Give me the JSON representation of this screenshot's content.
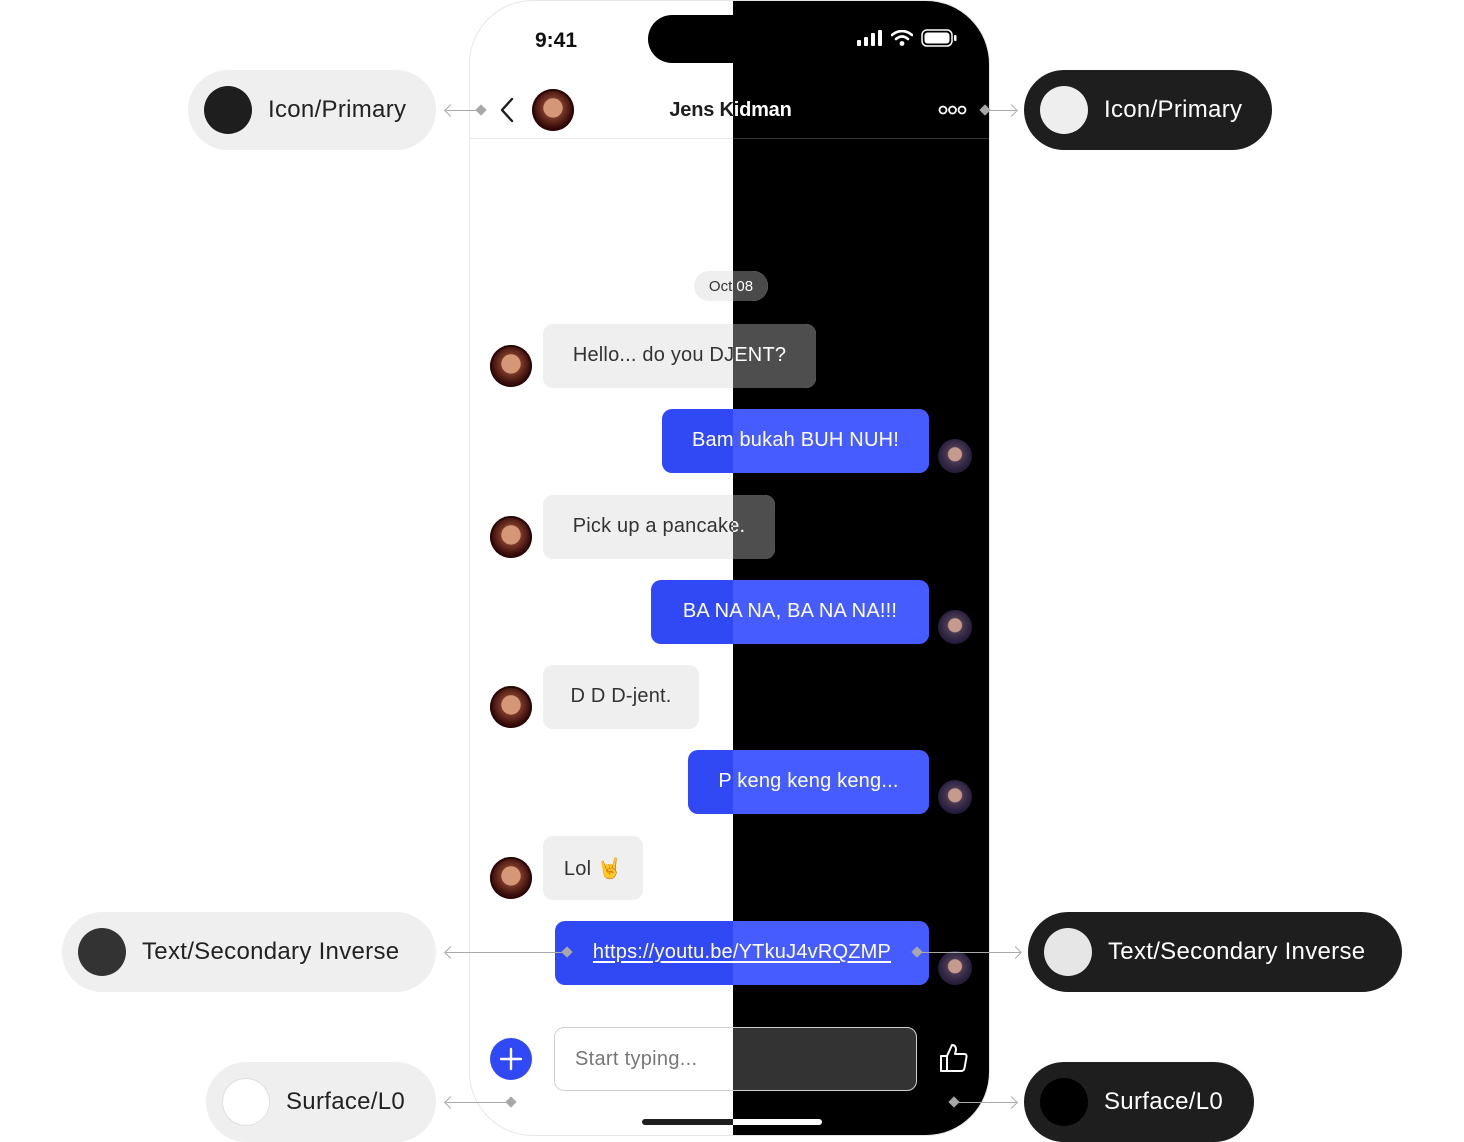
{
  "status_bar": {
    "time": "9:41"
  },
  "header": {
    "contact_name": "Jens Kidman"
  },
  "chat": {
    "date_label": "Oct 08",
    "messages": [
      {
        "side": "incoming",
        "text": "Hello... do you DJENT?"
      },
      {
        "side": "outgoing",
        "text": "Bam bukah BUH NUH!"
      },
      {
        "side": "incoming",
        "text": "Pick up a pancake."
      },
      {
        "side": "outgoing",
        "text": "BA NA NA, BA NA NA!!!"
      },
      {
        "side": "incoming",
        "text": "D D D-jent."
      },
      {
        "side": "outgoing",
        "text": "P keng keng keng..."
      },
      {
        "side": "incoming",
        "text": "Lol 🤘"
      },
      {
        "side": "outgoing",
        "text": "https://youtu.be/YTkuJ4vRQZMP",
        "is_link": true
      }
    ]
  },
  "composer": {
    "placeholder": "Start typing..."
  },
  "annotations": {
    "icon_primary_light": {
      "label": "Icon/Primary",
      "color": "#1e1e1e"
    },
    "icon_primary_dark": {
      "label": "Icon/Primary",
      "color": "#eeeeee"
    },
    "text_secondary_light": {
      "label": "Text/Secondary Inverse",
      "color": "#333333"
    },
    "text_secondary_dark": {
      "label": "Text/Secondary Inverse",
      "color": "#e6e6e6"
    },
    "surface_light": {
      "label": "Surface/L0",
      "color": "#ffffff"
    },
    "surface_dark": {
      "label": "Surface/L0",
      "color": "#000000"
    }
  },
  "colors": {
    "accent": "#3049f5",
    "accent_dark": "#465cff",
    "surface_light": "#ffffff",
    "surface_dark": "#000000"
  }
}
